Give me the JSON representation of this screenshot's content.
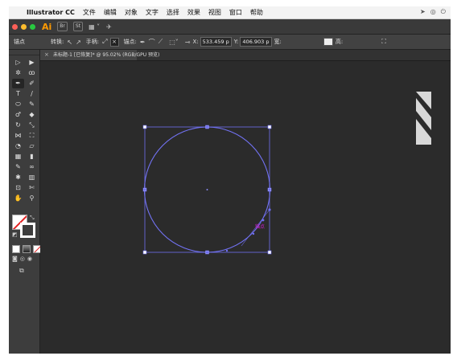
{
  "menubar": {
    "app_name": "Illustrator CC",
    "items": [
      "文件",
      "编辑",
      "对象",
      "文字",
      "选择",
      "效果",
      "视图",
      "窗口",
      "帮助"
    ],
    "status_icons": [
      "send-icon",
      "wifi-icon",
      "power-icon"
    ]
  },
  "appbar": {
    "logo": "Ai",
    "apps": [
      "Br",
      "St"
    ],
    "arrange_icon": "grid-icon",
    "extra_icon": "gpu-bolt-icon"
  },
  "control_bar": {
    "anchor_label": "锚点",
    "convert_label": "转换:",
    "handles_label": "手柄:",
    "anchors_label": "锚点:",
    "x_label": "X:",
    "x_value": "533.459 p",
    "y_label": "Y:",
    "y_value": "406.903 p",
    "w_label": "宽:",
    "h_label": "高:"
  },
  "document": {
    "tab_title": "未标题-1 [已恢复]* @ 95.02% (RGB/GPU 预览)"
  },
  "canvas": {
    "hover_label": "锚点",
    "colors": {
      "selection": "#6e6ef0",
      "hover_label": "#d61cd6",
      "shape_fill": "#d8d8d8",
      "canvas_bg": "#2b2b2b"
    }
  },
  "colors": {
    "fill_state": "none",
    "stroke_color": "#ffffff",
    "accent_orange": "#ff9a00"
  }
}
